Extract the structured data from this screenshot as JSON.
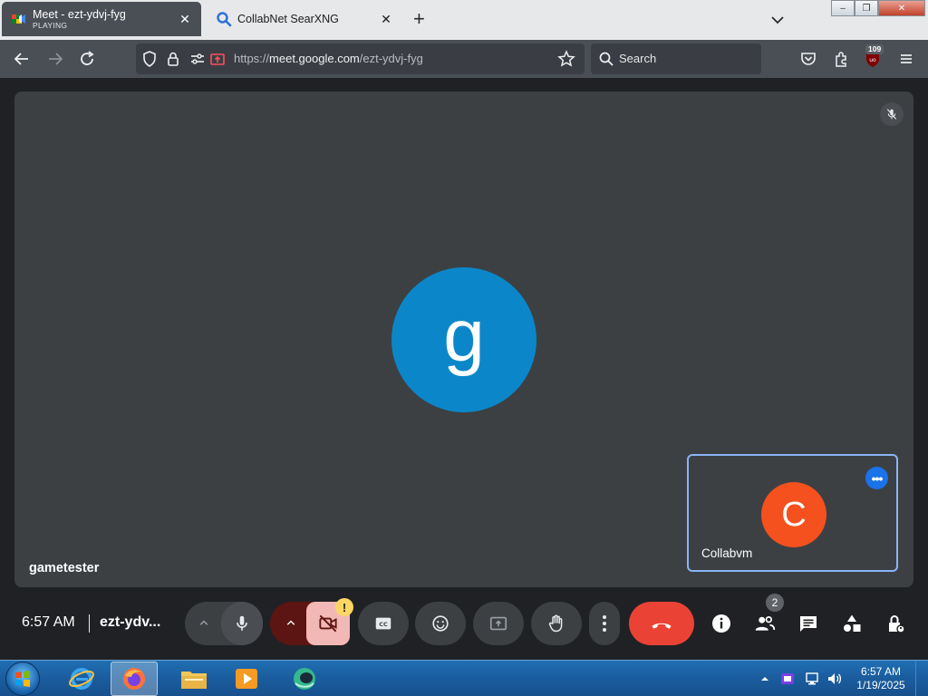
{
  "browser": {
    "tabs": [
      {
        "title": "Meet - ezt-ydvj-fyg",
        "subtitle": "PLAYING",
        "active": true
      },
      {
        "title": "CollabNet SearXNG",
        "active": false
      }
    ],
    "url_prefix": "https://",
    "url_host": "meet.google.com",
    "url_path": "/ezt-ydvj-fyg",
    "search_placeholder": "Search",
    "ublock_count": "109"
  },
  "meet": {
    "main_participant": {
      "initial": "g",
      "name": "gametester",
      "color": "#0b87c9"
    },
    "self_participant": {
      "initial": "C",
      "name": "Collabvm",
      "color": "#f4511e"
    },
    "time": "6:57 AM",
    "meeting_code": "ezt-ydv...",
    "people_count": "2",
    "camera_warning": "!"
  },
  "taskbar": {
    "clock_time": "6:57 AM",
    "clock_date": "1/19/2025",
    "apps": [
      "internet-explorer",
      "firefox",
      "file-explorer",
      "media-player",
      "collabvm-app"
    ]
  }
}
